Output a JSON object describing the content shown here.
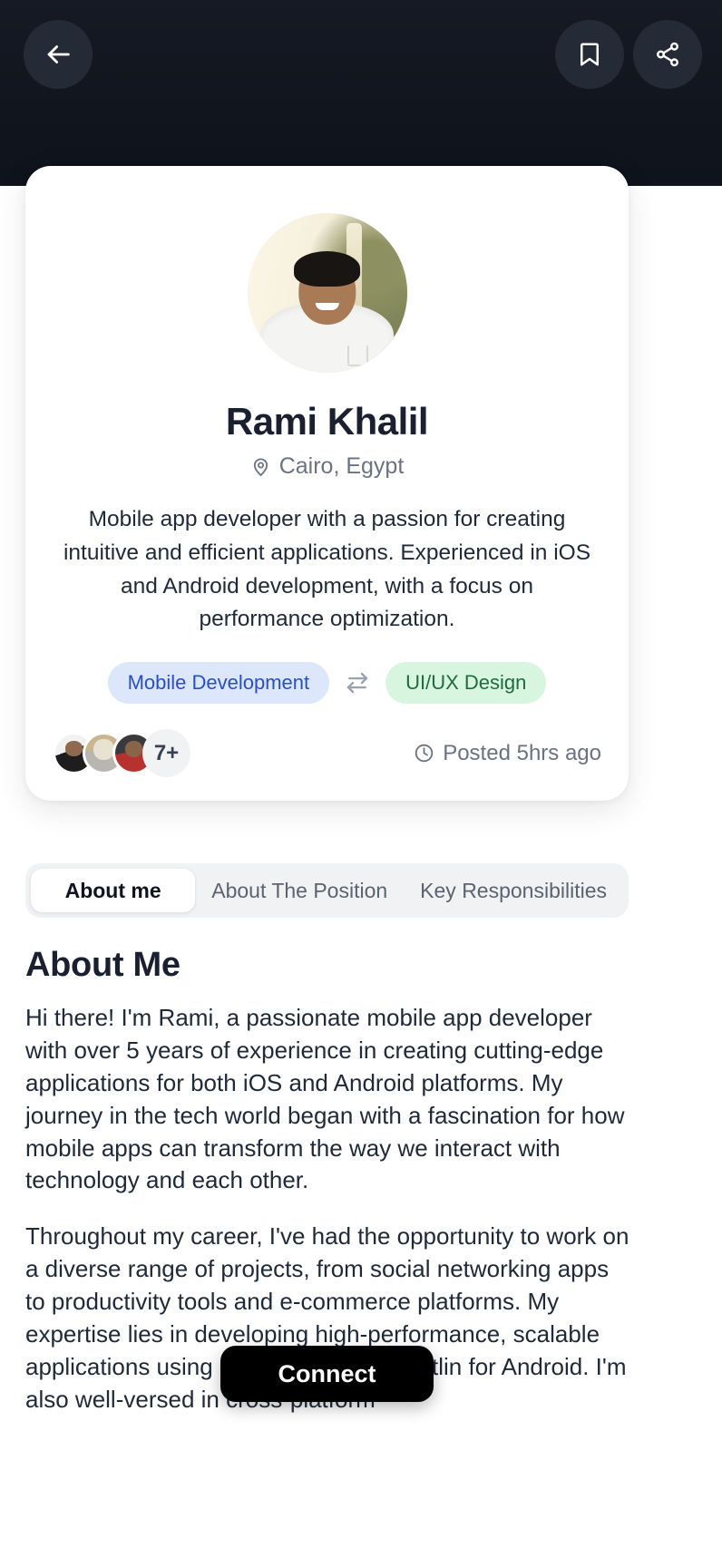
{
  "header": {
    "back_icon": "arrow-left-icon",
    "bookmark_icon": "bookmark-icon",
    "share_icon": "share-icon"
  },
  "profile": {
    "avatar_alt": "Rami Khalil profile photo",
    "name": "Rami Khalil",
    "location": "Cairo, Egypt",
    "location_icon": "map-pin-icon",
    "bio": "Mobile app developer with a passion for creating intuitive and efficient applications. Experienced in iOS and Android development, with a focus on performance optimization.",
    "tags": [
      {
        "label": "Mobile Development",
        "color": "#2a4fc4",
        "background": "#dce7fb"
      },
      {
        "label": "UI/UX Design",
        "color": "#1f6b3c",
        "background": "#d8f5e0"
      }
    ],
    "swap_icon": "swap-horizontal-icon",
    "applicants": {
      "extra_count": "7+",
      "avatars": [
        "applicant-avatar-1",
        "applicant-avatar-2",
        "applicant-avatar-3"
      ]
    },
    "posted": {
      "icon": "clock-icon",
      "text": "Posted 5hrs ago"
    }
  },
  "tabs": [
    {
      "label": "About me",
      "active": true
    },
    {
      "label": "About The Position",
      "active": false
    },
    {
      "label": "Key Responsibilities",
      "active": false
    }
  ],
  "about": {
    "title": "About Me",
    "paragraph_1": "Hi there! I'm Rami, a passionate mobile app developer with over 5 years of experience in creating cutting-edge applications for both iOS and Android platforms. My journey in the tech world began with a fascination for how mobile apps can transform the way we interact with technology and each other.",
    "paragraph_2": "Throughout my career, I've had the opportunity to work on a diverse range of projects, from social networking apps to productivity tools and e-commerce platforms. My expertise lies in developing high-performance, scalable applications using Swift for iOS and Kotlin for Android. I'm also well-versed in cross-platform"
  },
  "connect_button": {
    "label": "Connect",
    "background": "#000000",
    "text_color": "#ffffff"
  }
}
